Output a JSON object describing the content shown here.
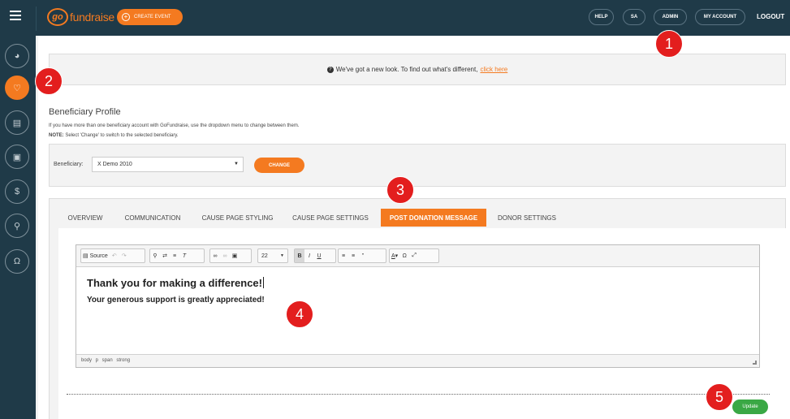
{
  "topbar": {
    "logo_go": "go",
    "logo_brand": "fundraise",
    "create_event_label": "CREATE EVENT",
    "nav": [
      "HELP",
      "SA",
      "ADMIN",
      "MY ACCOUNT"
    ],
    "logout_label": "LOGOUT"
  },
  "sidebar": {
    "icons": [
      "dashboard-icon",
      "heart-icon",
      "document-icon",
      "gift-icon",
      "dollar-icon",
      "ribbon-icon",
      "headset-icon"
    ],
    "active_index": 1
  },
  "notice": {
    "text": "We've got a new look. To find out what's different,",
    "link": "click here"
  },
  "profile": {
    "title": "Beneficiary Profile",
    "description": "If you have more than one beneficiary account with GoFundraise, use the dropdown menu to change between them.",
    "note_label": "NOTE:",
    "note_text": "Select 'Change' to switch to the selected beneficiary.",
    "beneficiary_label": "Beneficiary:",
    "beneficiary_value": "X Demo 2010",
    "change_label": "CHANGE"
  },
  "tabs": [
    "OVERVIEW",
    "COMMUNICATION",
    "CAUSE PAGE STYLING",
    "CAUSE PAGE SETTINGS",
    "POST DONATION MESSAGE",
    "DONOR SETTINGS"
  ],
  "active_tab": "POST DONATION MESSAGE",
  "editor": {
    "source_label": "Source",
    "font_size": "22",
    "heading": "Thank you for making a difference!",
    "paragraph": "Your generous support is greatly appreciated!",
    "path": "body  p  span  strong"
  },
  "update_label": "Update",
  "markers": [
    "1",
    "2",
    "3",
    "4",
    "5"
  ],
  "colors": {
    "accent": "#f47a20",
    "header": "#1f3a48",
    "marker": "#e31e1e",
    "update": "#3aa845"
  }
}
